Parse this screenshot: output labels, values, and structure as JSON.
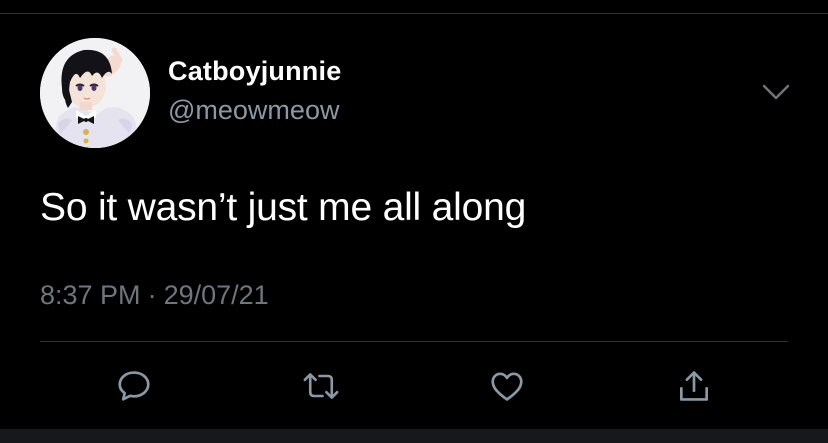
{
  "tweet": {
    "author": {
      "display_name": "Catboyjunnie",
      "handle": "@meowmeow",
      "avatar_icon": "anime-avatar"
    },
    "text": "So it wasn’t just me all along",
    "time": "8:37 PM",
    "separator": "·",
    "date": "29/07/21"
  },
  "actions": {
    "reply_icon": "speech-bubble-icon",
    "retweet_icon": "retweet-arrows-icon",
    "like_icon": "heart-icon",
    "share_icon": "share-upload-icon",
    "more_icon": "chevron-down-icon"
  },
  "colors": {
    "background": "#000000",
    "primary_text": "#ffffff",
    "secondary_text": "#8b98a5",
    "meta_text": "#6e767d",
    "icon": "#8b98a5",
    "divider": "#2f3336"
  }
}
